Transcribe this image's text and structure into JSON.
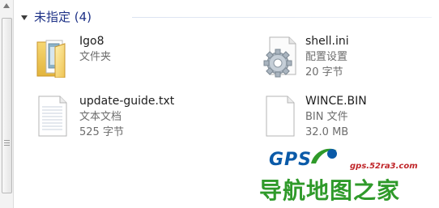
{
  "group": {
    "title": "未指定 (4)"
  },
  "files": [
    {
      "name": "Igo8",
      "type": "文件夹",
      "size": "",
      "icon": "folder-icon"
    },
    {
      "name": "shell.ini",
      "type": "配置设置",
      "size": "20 字节",
      "icon": "settings-file-icon"
    },
    {
      "name": "update-guide.txt",
      "type": "文本文档",
      "size": "525 字节",
      "icon": "text-file-icon"
    },
    {
      "name": "WINCE.BIN",
      "type": "BIN 文件",
      "size": "32.0 MB",
      "icon": "blank-file-icon"
    }
  ],
  "watermark": {
    "brand": "GPS",
    "url": "gps.52ra3.com",
    "slogan": "导航地图之家"
  }
}
